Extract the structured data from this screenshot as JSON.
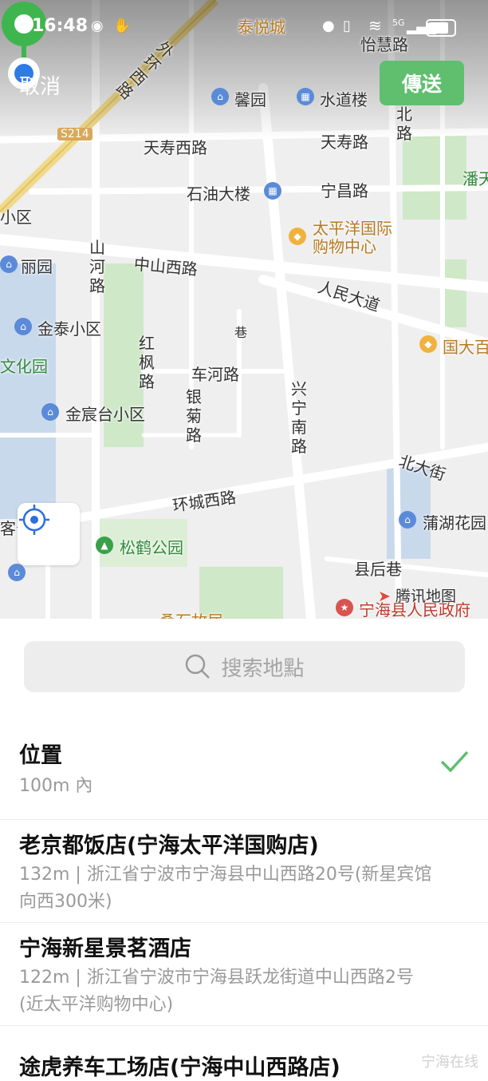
{
  "status_bar": {
    "time": "16:48",
    "network": "5G"
  },
  "header": {
    "cancel_label": "取消",
    "send_label": "傳送"
  },
  "map": {
    "labels": {
      "taiyue": "泰悦城",
      "yiyuan": "怡慧路",
      "xinyuan": "馨园",
      "shuidao": "水道楼",
      "tianshou_west": "天寿西路",
      "tianshou": "天寿路",
      "s214": "S214",
      "shiyou": "石油大楼",
      "ningchang": "宁昌路",
      "taipingyang": "太平洋国际",
      "taipingyang2": "购物中心",
      "xiaoqu": "小区",
      "liyuan": "丽园",
      "zhongshan_west": "中山西路",
      "renmin": "人民大道",
      "jintai": "金泰小区",
      "guodabai": "国大百",
      "wenhuayuan": "文化园",
      "chehe": "车河路",
      "jinchen": "金宸台小区",
      "xiang": "巷",
      "huancheng_west": "环城西路",
      "beida": "北大街",
      "puhu": "蒲湖花园",
      "songhe": "松鹤公园",
      "xianhou": "县后巷",
      "gov": "宁海县人民政府",
      "bottom_cut": "桑石故居",
      "ke": "客公",
      "pan": "潘天"
    },
    "vertical": {
      "waihuan": "外环西路",
      "shanhe": "山河路",
      "hongfeng": "红枫路",
      "yinju": "银菊路",
      "xingning": "兴宁南路",
      "bei": "北路"
    },
    "attribution": "腾讯地图"
  },
  "search": {
    "placeholder": "搜索地點"
  },
  "results": [
    {
      "title": "位置",
      "subtitle": "100m 內",
      "selected": true
    },
    {
      "title": "老京都饭店(宁海太平洋国购店)",
      "subtitle": "132m | 浙江省宁波市宁海县中山西路20号(新星宾馆向西300米)"
    },
    {
      "title": "宁海新星景茗酒店",
      "subtitle": "122m | 浙江省宁波市宁海县跃龙街道中山西路2号(近太平洋购物中心)"
    },
    {
      "title": "途虎养车工场店(宁海中山西路店)",
      "subtitle": ""
    }
  ],
  "watermark": "宁海在线",
  "colors": {
    "accent_green": "#5fbf6f",
    "pin_green": "#3fb54e",
    "location_blue": "#2f7be6"
  }
}
